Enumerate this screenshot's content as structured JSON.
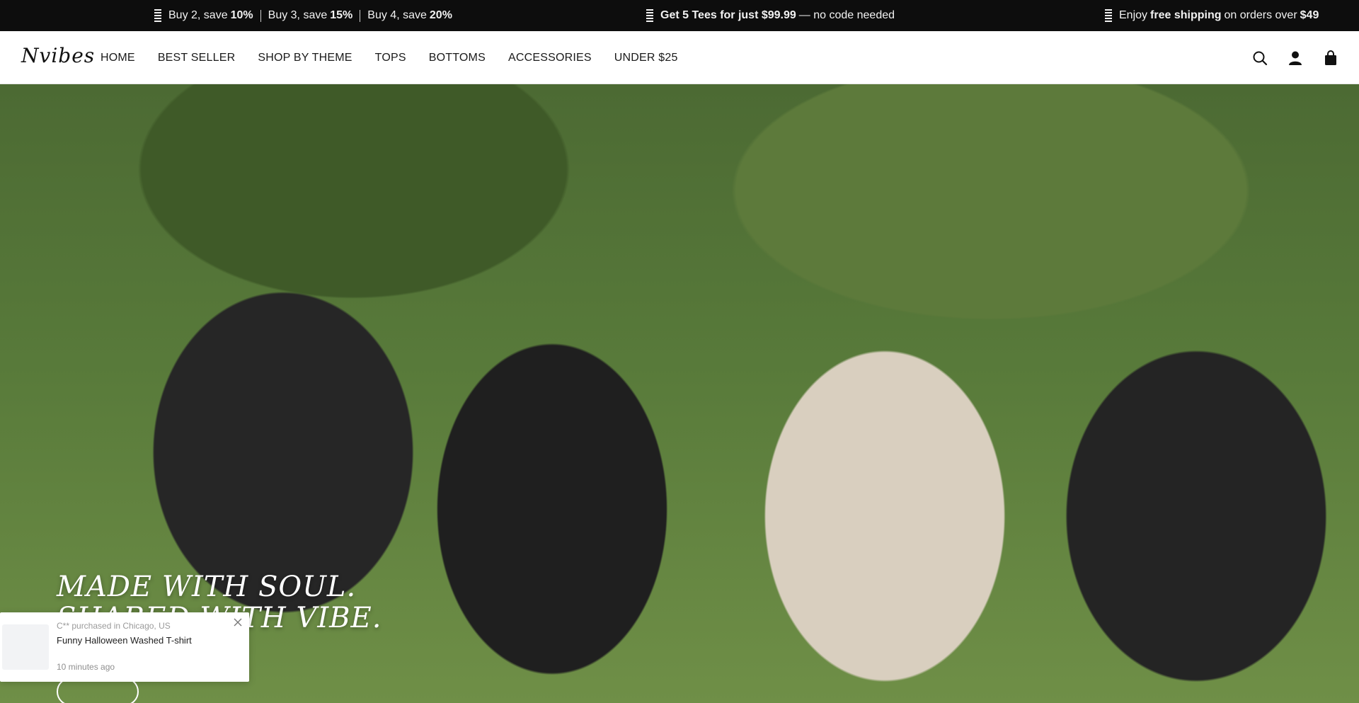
{
  "announcement": {
    "left": {
      "part1": "Buy 2, save ",
      "b1": "10%",
      "part2": "Buy 3, save ",
      "b2": "15%",
      "part3": "Buy 4, save ",
      "b3": "20%"
    },
    "center": {
      "bold": "Get 5 Tees for just $99.99",
      "rest": " — no code needed"
    },
    "right": {
      "part1": "Enjoy ",
      "b1": "free shipping",
      "part2": " on orders over ",
      "b2": "$49"
    }
  },
  "header": {
    "logo": "Nvibes",
    "nav": [
      "HOME",
      "BEST SELLER",
      "SHOP BY THEME",
      "TOPS",
      "BOTTOMS",
      "ACCESSORIES",
      "UNDER $25"
    ],
    "icons": [
      "search-icon",
      "account-icon",
      "cart-icon"
    ]
  },
  "hero": {
    "title_line1": "MADE WITH SOUL.",
    "title_line2": "SHARED WITH VIBE."
  },
  "toast": {
    "who": "C** purchased in Chicago, US",
    "product": "Funny Halloween Washed T-shirt",
    "time": "10 minutes ago"
  },
  "colors": {
    "announce_bg": "#0d0d0d",
    "header_bg": "#ffffff",
    "text_dark": "#111111"
  }
}
